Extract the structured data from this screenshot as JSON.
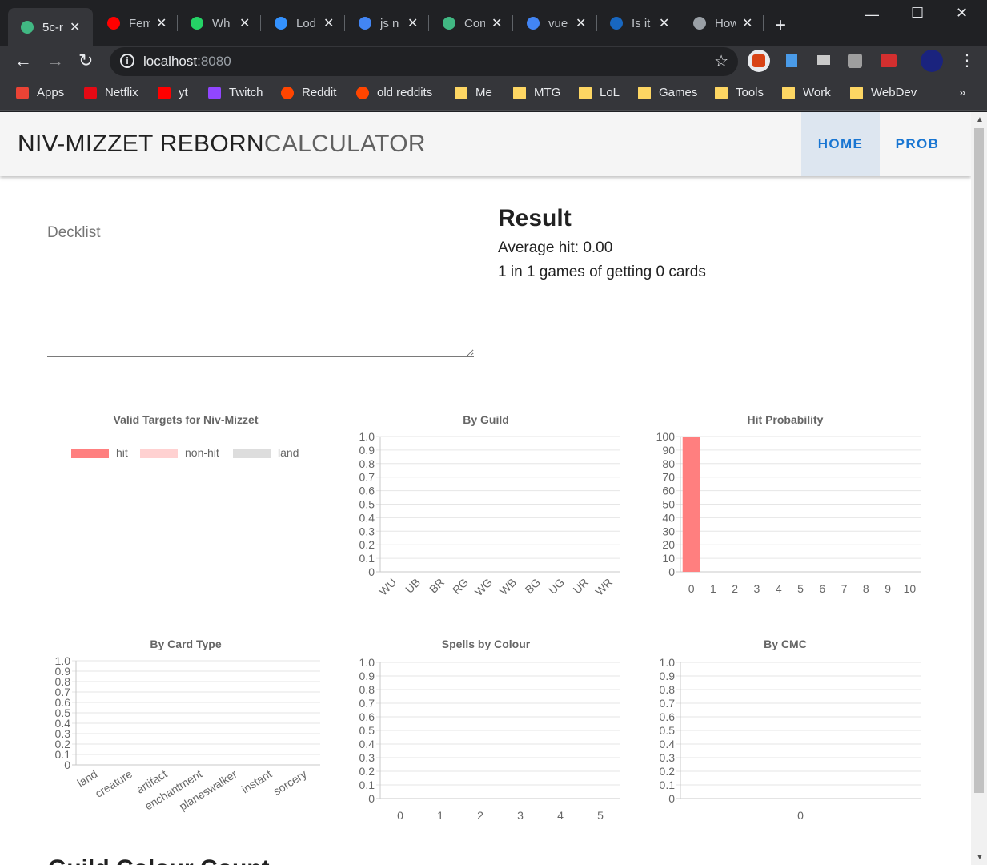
{
  "browser": {
    "tabs": [
      {
        "title": "5c-r",
        "icon": "vue-icon",
        "color": "#41b883",
        "active": true
      },
      {
        "title": "Fem",
        "icon": "youtube-icon",
        "color": "#ff0000"
      },
      {
        "title": "Wh",
        "icon": "whatsapp-icon",
        "color": "#25d366"
      },
      {
        "title": "Lod",
        "icon": "lodash-icon",
        "color": "#3492ff"
      },
      {
        "title": "js n",
        "icon": "google-icon",
        "color": "#4285f4"
      },
      {
        "title": "Con",
        "icon": "vue-icon",
        "color": "#41b883"
      },
      {
        "title": "vue",
        "icon": "google-icon",
        "color": "#4285f4"
      },
      {
        "title": "Is it",
        "icon": "vuetify-icon",
        "color": "#1867c0"
      },
      {
        "title": "How",
        "icon": "site-icon",
        "color": "#9aa0a6"
      }
    ],
    "url_host": "localhost",
    "url_port": ":8080",
    "bookmarks": [
      {
        "label": "Apps",
        "icon": "apps-icon"
      },
      {
        "label": "Netflix",
        "icon": "netflix-icon"
      },
      {
        "label": "yt",
        "icon": "youtube-icon"
      },
      {
        "label": "Twitch",
        "icon": "twitch-icon"
      },
      {
        "label": "Reddit",
        "icon": "reddit-icon"
      },
      {
        "label": "old reddits",
        "icon": "reddit-icon"
      },
      {
        "label": "Me",
        "icon": "folder-icon"
      },
      {
        "label": "MTG",
        "icon": "folder-icon"
      },
      {
        "label": "LoL",
        "icon": "folder-icon"
      },
      {
        "label": "Games",
        "icon": "folder-icon"
      },
      {
        "label": "Tools",
        "icon": "folder-icon"
      },
      {
        "label": "Work",
        "icon": "folder-icon"
      },
      {
        "label": "WebDev",
        "icon": "folder-icon"
      }
    ],
    "overflow": "»"
  },
  "app": {
    "title_bold": "NIV-MIZZET REBORN",
    "title_light": "CALCULATOR",
    "nav": [
      {
        "label": "HOME",
        "active": true
      },
      {
        "label": "PROB",
        "active": false
      }
    ],
    "decklist_label": "Decklist",
    "decklist_value": "",
    "result": {
      "heading": "Result",
      "average": "Average hit: 0.00",
      "odds": "1 in 1 games of getting 0 cards"
    },
    "next_section_heading": "Guild Colour Count"
  },
  "colors": {
    "hit": "#ff7f7f",
    "non_hit": "#ffd1d1",
    "land": "#dddddd",
    "accent": "#1976d2"
  },
  "chart_data": [
    {
      "type": "pie",
      "title": "Valid Targets for Niv-Mizzet",
      "legend": [
        "hit",
        "non-hit",
        "land"
      ],
      "legend_position": "top",
      "values": [
        0,
        0,
        0
      ]
    },
    {
      "type": "bar",
      "title": "By Guild",
      "categories": [
        "WU",
        "UB",
        "BR",
        "RG",
        "WG",
        "WB",
        "BG",
        "UG",
        "UR",
        "WR"
      ],
      "values": [
        0,
        0,
        0,
        0,
        0,
        0,
        0,
        0,
        0,
        0
      ],
      "ylim": [
        0,
        1.0
      ],
      "yticks": [
        "1.0",
        "0.9",
        "0.8",
        "0.7",
        "0.6",
        "0.5",
        "0.4",
        "0.3",
        "0.2",
        "0.1",
        "0"
      ],
      "grid": true
    },
    {
      "type": "bar",
      "title": "Hit Probability",
      "categories": [
        "0",
        "1",
        "2",
        "3",
        "4",
        "5",
        "6",
        "7",
        "8",
        "9",
        "10"
      ],
      "values": [
        100,
        0,
        0,
        0,
        0,
        0,
        0,
        0,
        0,
        0,
        0
      ],
      "ylim": [
        0,
        100
      ],
      "yticks": [
        "100",
        "90",
        "80",
        "70",
        "60",
        "50",
        "40",
        "30",
        "20",
        "10",
        "0"
      ],
      "grid": true
    },
    {
      "type": "bar",
      "title": "By Card Type",
      "categories": [
        "land",
        "creature",
        "artifact",
        "enchantment",
        "planeswalker",
        "instant",
        "sorcery"
      ],
      "values": [
        0,
        0,
        0,
        0,
        0,
        0,
        0
      ],
      "ylim": [
        0,
        1.0
      ],
      "yticks": [
        "1.0",
        "0.9",
        "0.8",
        "0.7",
        "0.6",
        "0.5",
        "0.4",
        "0.3",
        "0.2",
        "0.1",
        "0"
      ],
      "grid": true
    },
    {
      "type": "bar",
      "title": "Spells by Colour",
      "categories": [
        "0",
        "1",
        "2",
        "3",
        "4",
        "5"
      ],
      "values": [
        0,
        0,
        0,
        0,
        0,
        0
      ],
      "ylim": [
        0,
        1.0
      ],
      "yticks": [
        "1.0",
        "0.9",
        "0.8",
        "0.7",
        "0.6",
        "0.5",
        "0.4",
        "0.3",
        "0.2",
        "0.1",
        "0"
      ],
      "grid": true
    },
    {
      "type": "bar",
      "title": "By CMC",
      "categories": [
        "0"
      ],
      "values": [
        0
      ],
      "ylim": [
        0,
        1.0
      ],
      "yticks": [
        "1.0",
        "0.9",
        "0.8",
        "0.7",
        "0.6",
        "0.5",
        "0.4",
        "0.3",
        "0.2",
        "0.1",
        "0"
      ],
      "grid": true
    }
  ]
}
